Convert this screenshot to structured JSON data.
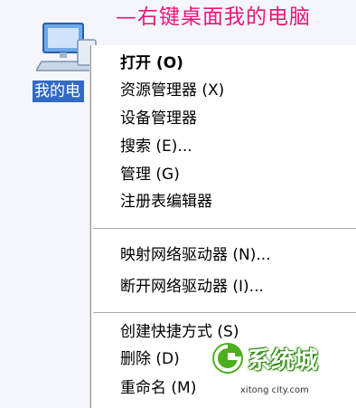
{
  "annotation": "—右键桌面我的电脑",
  "desktop_icon": {
    "label": "我的电",
    "icon": "my-computer-icon"
  },
  "menu": {
    "open": "打开 (O)",
    "explore": "资源管理器 (X)",
    "device_manager": "设备管理器",
    "search": "搜索 (E)...",
    "manage": "管理 (G)",
    "registry_editor": "注册表编辑器",
    "map_drive": "映射网络驱动器 (N)...",
    "disconnect_drive": "断开网络驱动器 (I)...",
    "create_shortcut": "创建快捷方式 (S)",
    "delete": "删除 (D)",
    "rename": "重命名 (M)"
  },
  "watermark": {
    "brand": "系统城",
    "url": "xitong city.com"
  },
  "colors": {
    "annotation": "#e8177a",
    "selection": "#316ac5",
    "logo_green": "#4caf1e"
  }
}
